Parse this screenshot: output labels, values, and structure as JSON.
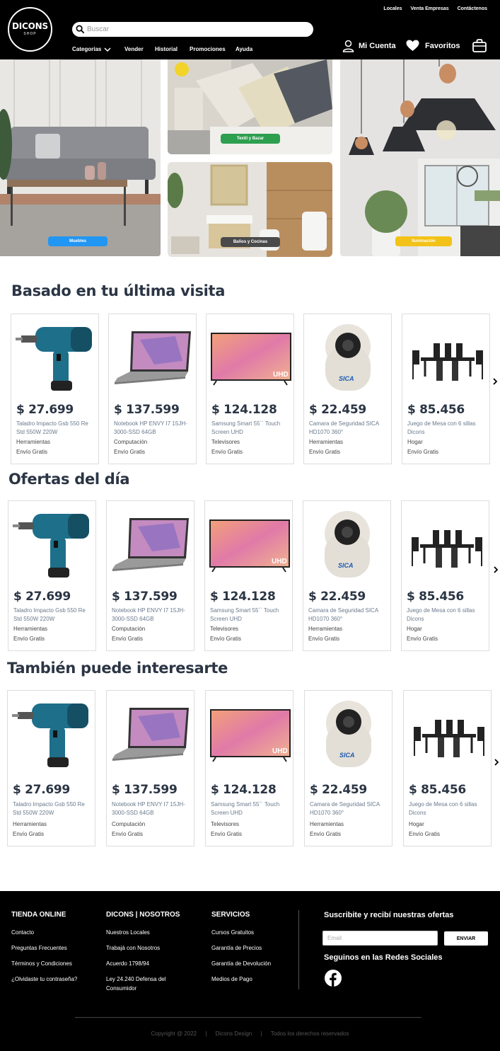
{
  "header": {
    "logo_main": "DICONS",
    "logo_sub": "SHOP",
    "top_links": [
      "Locales",
      "Venta Empresas",
      "Contáctenos"
    ],
    "search_placeholder": "Buscar",
    "nav": [
      "Categorías",
      "Vender",
      "Historial",
      "Promociones",
      "Ayuda"
    ],
    "account_label": "Mi Cuenta",
    "favorites_label": "Favoritos"
  },
  "hero": {
    "furniture_label": "Muebles",
    "textile_label": "Textil y Bazar",
    "bath_label": "Baños y Cocinas",
    "lighting_label": "Iluminación",
    "colors": {
      "furniture": "#2196f3",
      "textile": "#2e9e4f",
      "bath": "#4a4a4a",
      "lighting": "#f2c218"
    }
  },
  "sections": [
    {
      "title": "Basado en tu última visita",
      "products": [
        {
          "price": "$ 27.699",
          "name": "Taladro Impacto Gsb 550 Re Std 550W 220W",
          "category": "Herramientas",
          "shipping": "Envío Gratis"
        },
        {
          "price": "$ 137.599",
          "name": "Notebook HP ENVY I7 15JH-3000-SSD 64GB",
          "category": "Computación",
          "shipping": "Envío Gratis"
        },
        {
          "price": "$ 124.128",
          "name": "Samsung Smart 55´´ Touch Screen UHD",
          "category": "Televisores",
          "shipping": "Envío Gratis"
        },
        {
          "price": "$ 22.459",
          "name": "Camara de Seguridad SICA HD1070 360°",
          "category": "Herramientas",
          "shipping": "Envío Gratis"
        },
        {
          "price": "$ 85.456",
          "name": "Juego de Mesa con 6 sillas Dicons",
          "category": "Hogar",
          "shipping": "Envío Gratis"
        }
      ]
    },
    {
      "title": "Ofertas del día",
      "products": [
        {
          "price": "$ 27.699",
          "name": "Taladro Impacto Gsb 550 Re Std 550W 220W",
          "category": "Herramientas",
          "shipping": "Envío Gratis"
        },
        {
          "price": "$ 137.599",
          "name": "Notebook HP ENVY I7 15JH-3000-SSD 64GB",
          "category": "Computación",
          "shipping": "Envío Gratis"
        },
        {
          "price": "$ 124.128",
          "name": "Samsung Smart 55´´ Touch Screen UHD",
          "category": "Televisores",
          "shipping": "Envío Gratis"
        },
        {
          "price": "$ 22.459",
          "name": "Camara de Seguridad SICA HD1070 360°",
          "category": "Herramientas",
          "shipping": "Envío Gratis"
        },
        {
          "price": "$ 85.456",
          "name": "Juego de Mesa con 6 sillas Dicons",
          "category": "Hogar",
          "shipping": "Envío Gratis"
        }
      ]
    },
    {
      "title": "También puede interesarte",
      "products": [
        {
          "price": "$ 27.699",
          "name": "Taladro Impacto Gsb 550 Re Std 550W 220W",
          "category": "Herramientas",
          "shipping": "Envío Gratis"
        },
        {
          "price": "$ 137.599",
          "name": "Notebook HP ENVY I7 15JH-3000-SSD 64GB",
          "category": "Computación",
          "shipping": "Envío Gratis"
        },
        {
          "price": "$ 124.128",
          "name": "Samsung Smart 55´´ Touch Screen UHD",
          "category": "Televisores",
          "shipping": "Envío Gratis"
        },
        {
          "price": "$ 22.459",
          "name": "Camara de Seguridad SICA HD1070 360°",
          "category": "Herramientas",
          "shipping": "Envío Gratis"
        },
        {
          "price": "$ 85.456",
          "name": "Juego de Mesa con 6 sillas Dicons",
          "category": "Hogar",
          "shipping": "Envío Gratis"
        }
      ]
    }
  ],
  "product_images": [
    "drill-image",
    "laptop-image",
    "tv-image",
    "camera-image",
    "dining-set-image"
  ],
  "footer": {
    "col1": {
      "title": "TIENDA ONLINE",
      "links": [
        "Contacto",
        "Preguntas Frecuentes",
        "Términos y Condiciones",
        "¿Olvidaste tu contraseña?"
      ]
    },
    "col2": {
      "title": "DICONS | NOSOTROS",
      "links": [
        "Nuestros Locales",
        "Trabajá con Nosotros",
        "Acuerdo 1798/94",
        "Ley 24.240 Defensa del Consumidor"
      ]
    },
    "col3": {
      "title": "SERVICIOS",
      "links": [
        "Cursos Gratuitos",
        "Garantía de Precios",
        "Garantía de Devolución",
        "Medios de Pago"
      ]
    },
    "subscribe_title": "Suscribite y recibí nuestras ofertas",
    "email_placeholder": "Email",
    "send_label": "ENVIAR",
    "social_title": "Seguinos en las Redes Sociales",
    "copyright": [
      "Copyright @ 2022",
      "|",
      "Dicons Design",
      "|",
      "Todos los derechos reservados"
    ]
  }
}
